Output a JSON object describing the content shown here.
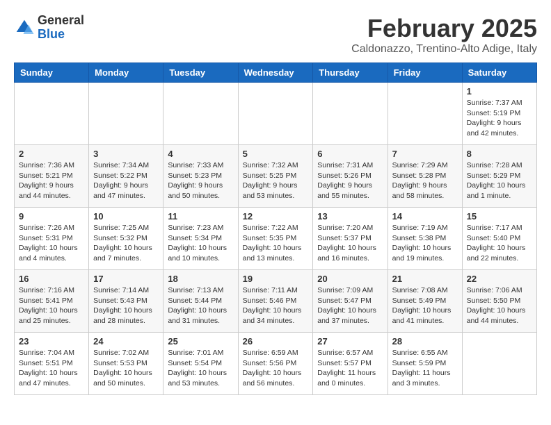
{
  "logo": {
    "general": "General",
    "blue": "Blue"
  },
  "header": {
    "month": "February 2025",
    "location": "Caldonazzo, Trentino-Alto Adige, Italy"
  },
  "weekdays": [
    "Sunday",
    "Monday",
    "Tuesday",
    "Wednesday",
    "Thursday",
    "Friday",
    "Saturday"
  ],
  "weeks": [
    [
      {
        "day": "",
        "info": ""
      },
      {
        "day": "",
        "info": ""
      },
      {
        "day": "",
        "info": ""
      },
      {
        "day": "",
        "info": ""
      },
      {
        "day": "",
        "info": ""
      },
      {
        "day": "",
        "info": ""
      },
      {
        "day": "1",
        "info": "Sunrise: 7:37 AM\nSunset: 5:19 PM\nDaylight: 9 hours and 42 minutes."
      }
    ],
    [
      {
        "day": "2",
        "info": "Sunrise: 7:36 AM\nSunset: 5:21 PM\nDaylight: 9 hours and 44 minutes."
      },
      {
        "day": "3",
        "info": "Sunrise: 7:34 AM\nSunset: 5:22 PM\nDaylight: 9 hours and 47 minutes."
      },
      {
        "day": "4",
        "info": "Sunrise: 7:33 AM\nSunset: 5:23 PM\nDaylight: 9 hours and 50 minutes."
      },
      {
        "day": "5",
        "info": "Sunrise: 7:32 AM\nSunset: 5:25 PM\nDaylight: 9 hours and 53 minutes."
      },
      {
        "day": "6",
        "info": "Sunrise: 7:31 AM\nSunset: 5:26 PM\nDaylight: 9 hours and 55 minutes."
      },
      {
        "day": "7",
        "info": "Sunrise: 7:29 AM\nSunset: 5:28 PM\nDaylight: 9 hours and 58 minutes."
      },
      {
        "day": "8",
        "info": "Sunrise: 7:28 AM\nSunset: 5:29 PM\nDaylight: 10 hours and 1 minute."
      }
    ],
    [
      {
        "day": "9",
        "info": "Sunrise: 7:26 AM\nSunset: 5:31 PM\nDaylight: 10 hours and 4 minutes."
      },
      {
        "day": "10",
        "info": "Sunrise: 7:25 AM\nSunset: 5:32 PM\nDaylight: 10 hours and 7 minutes."
      },
      {
        "day": "11",
        "info": "Sunrise: 7:23 AM\nSunset: 5:34 PM\nDaylight: 10 hours and 10 minutes."
      },
      {
        "day": "12",
        "info": "Sunrise: 7:22 AM\nSunset: 5:35 PM\nDaylight: 10 hours and 13 minutes."
      },
      {
        "day": "13",
        "info": "Sunrise: 7:20 AM\nSunset: 5:37 PM\nDaylight: 10 hours and 16 minutes."
      },
      {
        "day": "14",
        "info": "Sunrise: 7:19 AM\nSunset: 5:38 PM\nDaylight: 10 hours and 19 minutes."
      },
      {
        "day": "15",
        "info": "Sunrise: 7:17 AM\nSunset: 5:40 PM\nDaylight: 10 hours and 22 minutes."
      }
    ],
    [
      {
        "day": "16",
        "info": "Sunrise: 7:16 AM\nSunset: 5:41 PM\nDaylight: 10 hours and 25 minutes."
      },
      {
        "day": "17",
        "info": "Sunrise: 7:14 AM\nSunset: 5:43 PM\nDaylight: 10 hours and 28 minutes."
      },
      {
        "day": "18",
        "info": "Sunrise: 7:13 AM\nSunset: 5:44 PM\nDaylight: 10 hours and 31 minutes."
      },
      {
        "day": "19",
        "info": "Sunrise: 7:11 AM\nSunset: 5:46 PM\nDaylight: 10 hours and 34 minutes."
      },
      {
        "day": "20",
        "info": "Sunrise: 7:09 AM\nSunset: 5:47 PM\nDaylight: 10 hours and 37 minutes."
      },
      {
        "day": "21",
        "info": "Sunrise: 7:08 AM\nSunset: 5:49 PM\nDaylight: 10 hours and 41 minutes."
      },
      {
        "day": "22",
        "info": "Sunrise: 7:06 AM\nSunset: 5:50 PM\nDaylight: 10 hours and 44 minutes."
      }
    ],
    [
      {
        "day": "23",
        "info": "Sunrise: 7:04 AM\nSunset: 5:51 PM\nDaylight: 10 hours and 47 minutes."
      },
      {
        "day": "24",
        "info": "Sunrise: 7:02 AM\nSunset: 5:53 PM\nDaylight: 10 hours and 50 minutes."
      },
      {
        "day": "25",
        "info": "Sunrise: 7:01 AM\nSunset: 5:54 PM\nDaylight: 10 hours and 53 minutes."
      },
      {
        "day": "26",
        "info": "Sunrise: 6:59 AM\nSunset: 5:56 PM\nDaylight: 10 hours and 56 minutes."
      },
      {
        "day": "27",
        "info": "Sunrise: 6:57 AM\nSunset: 5:57 PM\nDaylight: 11 hours and 0 minutes."
      },
      {
        "day": "28",
        "info": "Sunrise: 6:55 AM\nSunset: 5:59 PM\nDaylight: 11 hours and 3 minutes."
      },
      {
        "day": "",
        "info": ""
      }
    ]
  ]
}
